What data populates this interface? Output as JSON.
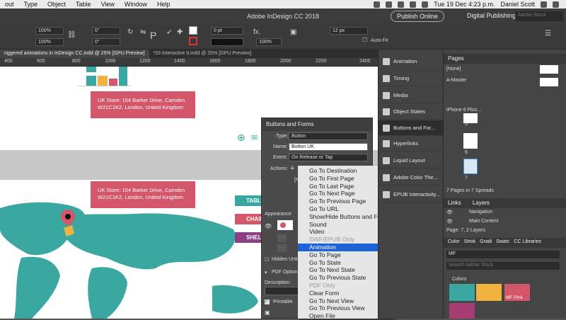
{
  "menubar": {
    "items": [
      "out",
      "Type",
      "Object",
      "Table",
      "View",
      "Window",
      "Help"
    ],
    "clock": "Tue 19 Dec 4:23 p.m.",
    "user": "Daniel Scott"
  },
  "titlebar": {
    "title": "Adobe InDesign CC 2018",
    "publish_label": "Publish Online",
    "workspace": "Digital Publishing",
    "stock_placeholder": "Adobe Stock"
  },
  "controlbar": {
    "zoom1": "100%",
    "zoom2": "100%",
    "angle1": "0°",
    "angle2": "0°",
    "stroke": "0 pt",
    "zoom3": "100%",
    "size": "12 px",
    "autofit": "Auto-Fit"
  },
  "doc_tabs": [
    "riggered animations in InDesign CC.indd @ 25% [GPU Preview]",
    "*03 Interactive 8.indd @ 25% [GPU Preview]"
  ],
  "ruler": [
    "400",
    "600",
    "800",
    "1000",
    "1200",
    "1400",
    "1600",
    "1800",
    "2000",
    "2200",
    "2400"
  ],
  "canvas": {
    "bubble_line1": "UK Store: 154 Barker Drive, Camden",
    "bubble_line2": "W21C1K2, London, United Kingdom",
    "ribbons": [
      "TABLE",
      "CHAIR",
      "SHELVE"
    ]
  },
  "buttons_forms": {
    "title": "Buttons and Forms",
    "type_label": "Type:",
    "type_value": "Button",
    "name_label": "Name:",
    "name_value": "Button UK",
    "event_label": "Event:",
    "event_value": "On Release or Tap",
    "actions_label": "Actions:",
    "appearance_label": "Appearance",
    "hidden_label": "Hidden Until T",
    "pdf_options": "PDF Options",
    "description_label": "Description:",
    "printable_label": "Printable",
    "n_label": "[N"
  },
  "action_menu": [
    {
      "label": "Go To Destination",
      "state": "normal"
    },
    {
      "label": "Go To First Page",
      "state": "normal"
    },
    {
      "label": "Go To Last Page",
      "state": "normal"
    },
    {
      "label": "Go To Next Page",
      "state": "normal"
    },
    {
      "label": "Go To Previous Page",
      "state": "normal"
    },
    {
      "label": "Go To URL",
      "state": "normal"
    },
    {
      "label": "Show/Hide Buttons and Forms",
      "state": "normal"
    },
    {
      "label": "Sound",
      "state": "normal"
    },
    {
      "label": "Video",
      "state": "normal"
    },
    {
      "label": "SWF/EPUB Only",
      "state": "disabled"
    },
    {
      "label": "Animation",
      "state": "selected"
    },
    {
      "label": "Go To Page",
      "state": "normal"
    },
    {
      "label": "Go To State",
      "state": "normal"
    },
    {
      "label": "Go To Next State",
      "state": "normal"
    },
    {
      "label": "Go To Previous State",
      "state": "normal"
    },
    {
      "label": "PDF Only",
      "state": "disabled"
    },
    {
      "label": "Clear Form",
      "state": "normal"
    },
    {
      "label": "Go To Next View",
      "state": "normal"
    },
    {
      "label": "Go To Previous View",
      "state": "normal"
    },
    {
      "label": "Open File",
      "state": "normal"
    }
  ],
  "mid_panel": [
    "Animation",
    "Timing",
    "Media",
    "Object States",
    "Buttons and For...",
    "Hyperlinks",
    "Liquid Layout",
    "Adobe Color The...",
    "EPUB Interactivity..."
  ],
  "pages_panel": {
    "title": "Pages",
    "none": "[None]",
    "master": "A-Master",
    "device": "iPhone 6 Plus...",
    "page_numbers": [
      "5",
      "6",
      "7"
    ],
    "footer": "7 Pages in 7 Spreads"
  },
  "layers_panel": {
    "tabs": [
      "Links",
      "Layers"
    ],
    "layers": [
      "Navigation",
      "Main Content"
    ],
    "footer": "Page: 7, 2 Layers"
  },
  "libraries_panel": {
    "tabs": [
      "Color",
      "Strok",
      "Gradi",
      "Swatc",
      "CC Libraries"
    ],
    "library": "MF",
    "search_placeholder": "Search Adobe Stock",
    "section": "Colors",
    "swatch_label": "MF Pink",
    "swatch_colors": [
      "#3aa8a0",
      "#f0b33e",
      "#d4566b",
      "#a53d72"
    ]
  }
}
